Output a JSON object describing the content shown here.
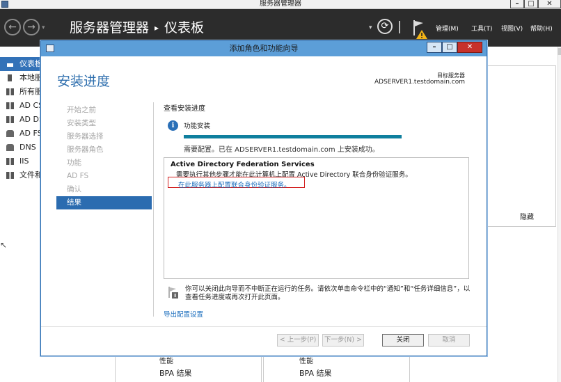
{
  "outer_window": {
    "title": "服务器管理器"
  },
  "header": {
    "breadcrumb_app": "服务器管理器",
    "breadcrumb_sep": "▸",
    "breadcrumb_page": "仪表板",
    "menus": {
      "manage": "管理(M)",
      "tools": "工具(T)",
      "view": "视图(V)",
      "help": "帮助(H)"
    }
  },
  "sidebar": {
    "items": [
      {
        "label": "仪表板",
        "icon": "dashboard-icon",
        "active": true
      },
      {
        "label": "本地服",
        "icon": "local-server-icon"
      },
      {
        "label": "所有服",
        "icon": "all-servers-icon"
      },
      {
        "label": "AD CS",
        "icon": "ad-cs-icon"
      },
      {
        "label": "AD DS",
        "icon": "ad-ds-icon"
      },
      {
        "label": "AD FS",
        "icon": "ad-fs-icon"
      },
      {
        "label": "DNS",
        "icon": "dns-icon"
      },
      {
        "label": "IIS",
        "icon": "iis-icon"
      },
      {
        "label": "文件和",
        "icon": "file-services-icon"
      }
    ]
  },
  "dashboard": {
    "hide_label": "隐藏",
    "tiles": [
      {
        "perf_label": "性能",
        "bpa_label": "BPA 结果"
      },
      {
        "perf_label": "性能",
        "bpa_label": "BPA 结果"
      }
    ]
  },
  "wizard": {
    "title": "添加角色和功能向导",
    "heading": "安装进度",
    "target_label": "目标服务器",
    "target_server": "ADSERVER1.testdomain.com",
    "steps": [
      {
        "label": "开始之前"
      },
      {
        "label": "安装类型"
      },
      {
        "label": "服务器选择"
      },
      {
        "label": "服务器角色"
      },
      {
        "label": "功能"
      },
      {
        "label": "AD FS"
      },
      {
        "label": "确认"
      },
      {
        "label": "结果",
        "active": true
      }
    ],
    "view_progress_label": "查看安装进度",
    "feature_install_label": "功能安装",
    "progress_fraction": 1.0,
    "progress_status": "需要配置。已在 ADSERVER1.testdomain.com 上安装成功。",
    "result": {
      "title": "Active Directory Federation Services",
      "description": "需要执行其他步骤才能在此计算机上配置 Active Directory 联合身份验证服务。",
      "link": "在此服务器上配置联合身份验证服务。"
    },
    "note": "你可以关闭此向导而不中断正在运行的任务。请依次单击命令栏中的“通知”和“任务详细信息”，以查看任务进度或再次打开此页面。",
    "export_link": "导出配置设置",
    "buttons": {
      "prev": "< 上一步(P)",
      "next": "下一步(N) >",
      "close": "关闭",
      "cancel": "取消"
    }
  },
  "colors": {
    "header_bg": "#2c2c2c",
    "wizard_title_bg": "#5c9ed8",
    "accent_blue": "#2b6cb0",
    "progress_fill": "#0f7f9e",
    "link": "#1a6dbd",
    "highlight_box": "#d32020",
    "close_red": "#c7312b"
  }
}
